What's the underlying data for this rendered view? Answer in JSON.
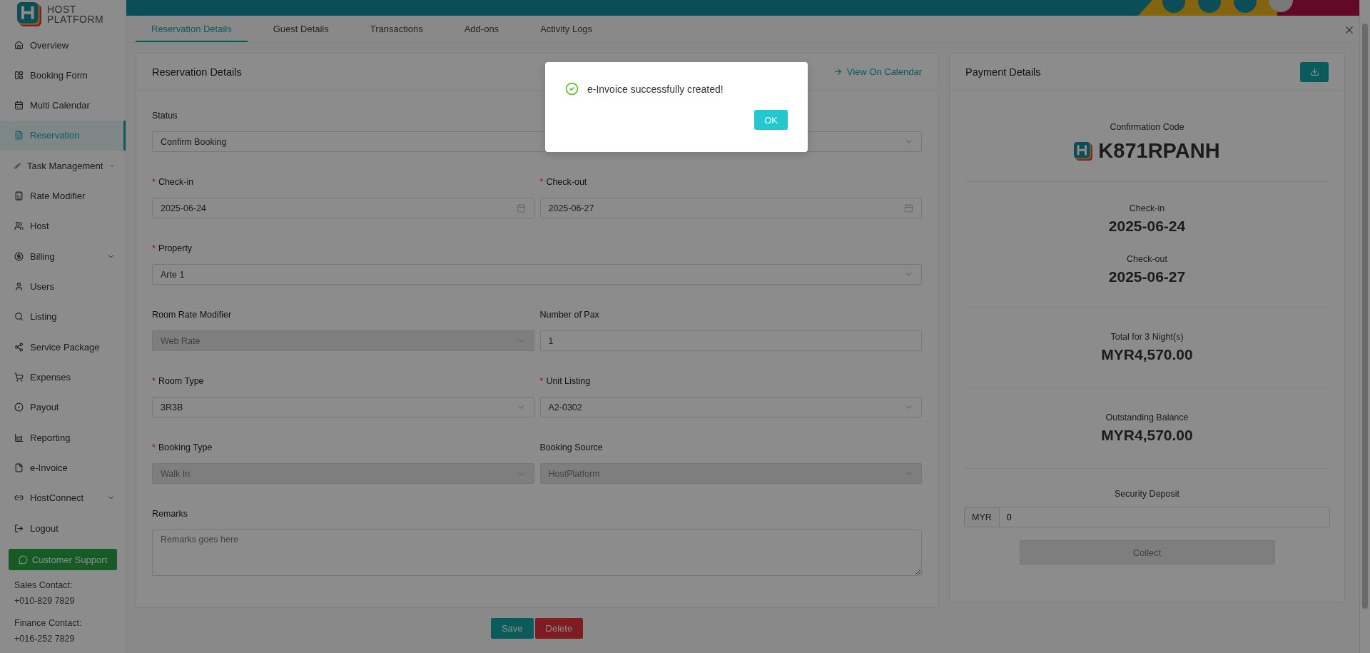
{
  "brand": {
    "line_1": "HOST",
    "line_2": "PLATFORM"
  },
  "sidebar": {
    "items": [
      {
        "label": "Overview",
        "selected": false,
        "has_submenu": false
      },
      {
        "label": "Booking Form",
        "selected": false,
        "has_submenu": false
      },
      {
        "label": "Multi Calendar",
        "selected": false,
        "has_submenu": false
      },
      {
        "label": "Reservation",
        "selected": true,
        "has_submenu": false
      },
      {
        "label": "Task Management",
        "selected": false,
        "has_submenu": true
      },
      {
        "label": "Rate Modifier",
        "selected": false,
        "has_submenu": false
      },
      {
        "label": "Host",
        "selected": false,
        "has_submenu": false
      },
      {
        "label": "Billing",
        "selected": false,
        "has_submenu": true
      },
      {
        "label": "Users",
        "selected": false,
        "has_submenu": false
      },
      {
        "label": "Listing",
        "selected": false,
        "has_submenu": false
      },
      {
        "label": "Service Package",
        "selected": false,
        "has_submenu": false
      },
      {
        "label": "Expenses",
        "selected": false,
        "has_submenu": false
      },
      {
        "label": "Payout",
        "selected": false,
        "has_submenu": false
      },
      {
        "label": "Reporting",
        "selected": false,
        "has_submenu": false
      },
      {
        "label": "e-Invoice",
        "selected": false,
        "has_submenu": false
      },
      {
        "label": "HostConnect",
        "selected": false,
        "has_submenu": true
      },
      {
        "label": "Logout",
        "selected": false,
        "has_submenu": false
      }
    ],
    "support_button": "Customer Support",
    "contacts": [
      {
        "label": "Sales Contact:",
        "phone": "+010-829 7829"
      },
      {
        "label": "Finance Contact:",
        "phone": "+016-252 7829"
      }
    ]
  },
  "tabs": [
    {
      "label": "Reservation Details",
      "selected": true
    },
    {
      "label": "Guest Details",
      "selected": false
    },
    {
      "label": "Transactions",
      "selected": false
    },
    {
      "label": "Add-ons",
      "selected": false
    },
    {
      "label": "Activity Logs",
      "selected": false
    }
  ],
  "reservation": {
    "title": "Reservation Details",
    "calendar_link": "View On Calendar",
    "rows": [
      {
        "fields": [
          {
            "label": "Status",
            "kind": "select",
            "value": "Confirm Booking",
            "disabled": false
          }
        ]
      },
      {
        "fields": [
          {
            "label": "Check-in",
            "required_mark": "*",
            "kind": "date",
            "value": "2025-06-24",
            "disabled": false
          },
          {
            "label": "Check-out",
            "required_mark": "*",
            "kind": "date",
            "value": "2025-06-27",
            "disabled": false
          }
        ]
      },
      {
        "fields": [
          {
            "label": "Property",
            "required_mark": "*",
            "kind": "select",
            "value": "Arte 1",
            "disabled": false
          }
        ]
      },
      {
        "fields": [
          {
            "label": "Room Rate Modifier",
            "kind": "select",
            "value": "Web Rate",
            "disabled": true
          },
          {
            "label": "Number of Pax",
            "kind": "input",
            "value": "1",
            "disabled": false
          }
        ]
      },
      {
        "fields": [
          {
            "label": "Room Type",
            "required_mark": "*",
            "kind": "select",
            "value": "3R3B",
            "disabled": false
          },
          {
            "label": "Unit Listing",
            "required_mark": "*",
            "kind": "select",
            "value": "A2-0302",
            "disabled": false
          }
        ]
      },
      {
        "fields": [
          {
            "label": "Booking Type",
            "required_mark": "*",
            "kind": "select",
            "value": "Walk In",
            "disabled": true
          },
          {
            "label": "Booking Source",
            "kind": "select",
            "value": "HostPlatform",
            "disabled": true
          }
        ]
      },
      {
        "fields": [
          {
            "label": "Remarks",
            "kind": "textarea",
            "placeholder": "Remarks goes here"
          }
        ]
      }
    ]
  },
  "payment": {
    "title": "Payment Details",
    "summary": [
      {
        "label": "Confirmation Code",
        "value": "K871RPANH",
        "kind": "code"
      },
      {
        "label": "Check-in",
        "value": "2025-06-24",
        "kind": "date"
      },
      {
        "label": "Check-out",
        "value": "2025-06-27",
        "kind": "date"
      },
      {
        "label": "Total for 3 Night(s)",
        "value": "MYR4,570.00",
        "kind": "amount"
      },
      {
        "label": "Outstanding Balance",
        "value": "MYR4,570.00",
        "kind": "amount"
      }
    ],
    "security_deposit": {
      "label": "Security Deposit",
      "currency": "MYR",
      "value": "0"
    },
    "collect_button": {
      "label": "Collect",
      "disabled": true
    }
  },
  "actions": [
    {
      "label": "Save",
      "kind": "primary"
    },
    {
      "label": "Delete",
      "kind": "danger"
    }
  ],
  "dialog": {
    "message": "e-Invoice successfully created!",
    "button": "OK"
  }
}
